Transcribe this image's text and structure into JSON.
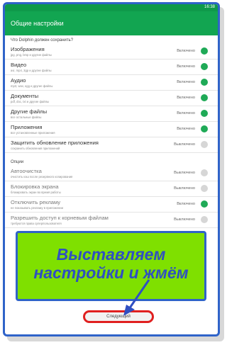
{
  "status": {
    "time": "16:38"
  },
  "appbar": {
    "title": "Общие настройки"
  },
  "section1": {
    "label": "Что Dolphin должен сохранить?",
    "items": [
      {
        "name": "Изображения",
        "desc": "jpg, png, bmp и другие файлы",
        "state": "Включено",
        "on": true
      },
      {
        "name": "Видео",
        "desc": "avi, mp4, 3gp и другие файлы",
        "state": "Включено",
        "on": true
      },
      {
        "name": "Аудио",
        "desc": "mp3, wav, ogg и другие файлы",
        "state": "Включено",
        "on": true
      },
      {
        "name": "Документы",
        "desc": "pdf, doc, txt и другие файлы",
        "state": "Включено",
        "on": true
      },
      {
        "name": "Другие файлы",
        "desc": "все остальные файлы",
        "state": "Включено",
        "on": true
      },
      {
        "name": "Приложения",
        "desc": "все установленные приложения",
        "state": "Включено",
        "on": true
      },
      {
        "name": "Защитить обновление приложения",
        "desc": "сохранить обновления приложений",
        "state": "Выключено",
        "on": false
      }
    ]
  },
  "section2": {
    "label": "Опции",
    "items": [
      {
        "name": "Автоочистка",
        "desc": "очистить кэш после резервного копирования",
        "state": "Выключено",
        "on": false
      },
      {
        "name": "Блокировка экрана",
        "desc": "блокировать экран во время работы",
        "state": "Выключено",
        "on": false
      },
      {
        "name": "Отключить рекламу",
        "desc": "не показывать рекламу в приложении",
        "state": "Включено",
        "on": true
      },
      {
        "name": "Разрешить доступ к корневым файлам",
        "desc": "требуются права суперпользователя",
        "state": "Выключено",
        "on": false
      }
    ]
  },
  "more_text": "• • • • •",
  "callout": {
    "line1": "Выставляем",
    "line2": "настройки и жмём"
  },
  "next_button": {
    "label": "Следующий"
  },
  "colors": {
    "green": "#12a551",
    "toggle_on": "#1faa57",
    "frame_blue": "#2f63c9",
    "callout_bg": "#7fe000",
    "button_outline": "#e02020"
  }
}
